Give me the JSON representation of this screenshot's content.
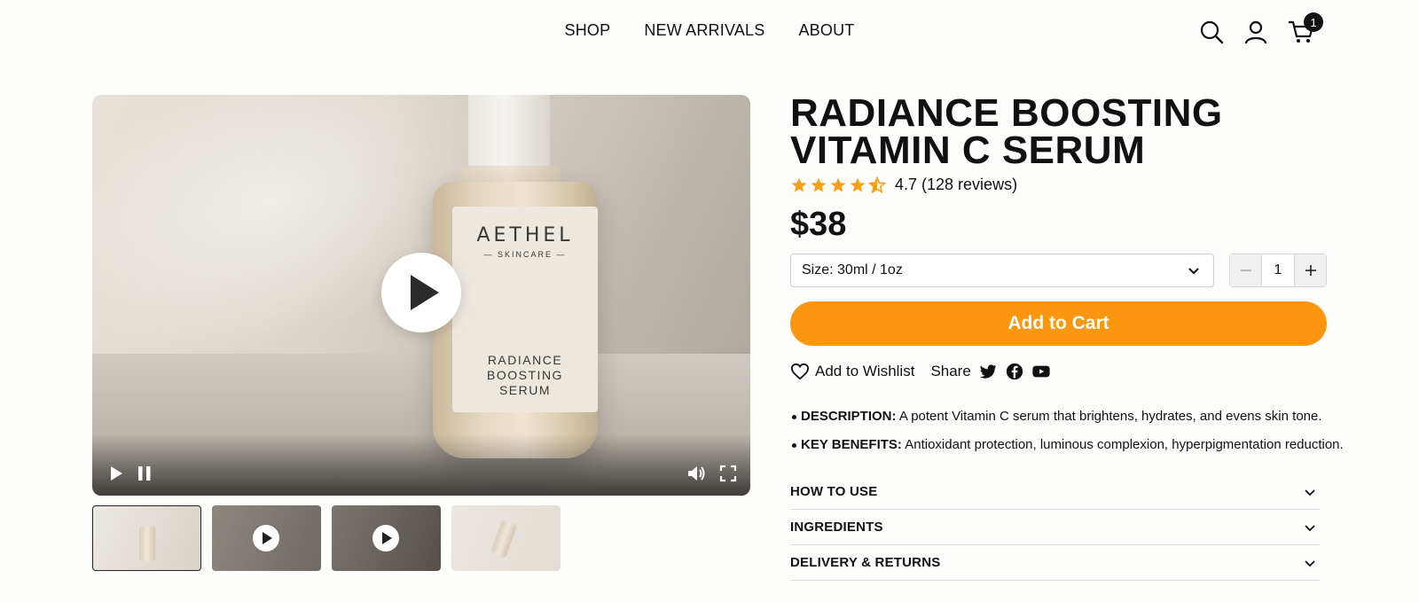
{
  "nav": {
    "items": [
      "SHOP",
      "NEW ARRIVALS",
      "ABOUT"
    ]
  },
  "header": {
    "cart_count": "1",
    "icons": [
      "search-icon",
      "user-icon",
      "cart-icon"
    ]
  },
  "media": {
    "bottle_brand": "AETHEL",
    "bottle_sub": "— SKINCARE —",
    "bottle_name_1": "RADIANCE",
    "bottle_name_2": "BOOSTING",
    "bottle_name_3": "SERUM"
  },
  "thumbnails": [
    {
      "kind": "image",
      "active": true
    },
    {
      "kind": "video"
    },
    {
      "kind": "video"
    },
    {
      "kind": "image"
    }
  ],
  "product": {
    "title_line1": "RADIANCE BOOSTING",
    "title_line2": "VITAMIN C SERUM",
    "rating_value": 4.5,
    "rating_text": "4.7 (128 reviews)",
    "price": "$38",
    "size_label": "Size: 30ml / 1oz",
    "quantity": "1",
    "add_to_cart": "Add to Cart",
    "wishlist": "Add to Wishlist",
    "share": "Share",
    "description_label": "DESCRIPTION:",
    "description_text": " A potent Vitamin C serum that brightens, hydrates, and evens skin tone.",
    "benefits_label": "KEY BENEFITS:",
    "benefits_text": " Antioxidant protection, luminous complexion, hyperpigmentation reduction."
  },
  "accordion": [
    "HOW TO USE",
    "INGREDIENTS",
    "DELIVERY & RETURNS"
  ],
  "colors": {
    "accent": "#fb9611",
    "star": "#f5a01a",
    "text": "#111111"
  }
}
